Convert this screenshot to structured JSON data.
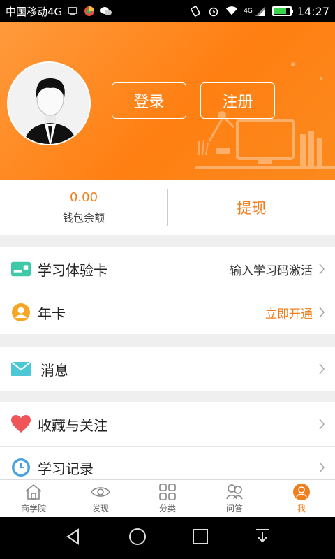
{
  "status_bar": {
    "carrier": "中国移动4G",
    "network_badge": "4G",
    "time": "14:27",
    "icons": [
      "usb-icon",
      "app-icon",
      "wechat-icon",
      "vibrate-icon",
      "alarm-icon",
      "wifi-icon",
      "signal-icon",
      "battery-icon"
    ]
  },
  "header": {
    "login_label": "登录",
    "register_label": "注册"
  },
  "wallet": {
    "balance": "0.00",
    "balance_label": "钱包余额",
    "withdraw_label": "提现"
  },
  "menu": {
    "trial_card": {
      "label": "学习体验卡",
      "action": "输入学习码激活"
    },
    "annual_card": {
      "label": "年卡",
      "action": "立即开通"
    },
    "messages": {
      "label": "消息"
    },
    "favorites": {
      "label": "收藏与关注"
    },
    "history": {
      "label": "学习记录"
    }
  },
  "tabs": [
    {
      "label": "商学院",
      "icon": "home-icon"
    },
    {
      "label": "发现",
      "icon": "eye-icon"
    },
    {
      "label": "分类",
      "icon": "grid-icon"
    },
    {
      "label": "问答",
      "icon": "people-icon"
    },
    {
      "label": "我",
      "icon": "user-icon"
    }
  ],
  "colors": {
    "accent": "#f07e1c",
    "header": "#ff8418",
    "trial_icon": "#3fc9a8",
    "annual_icon": "#f5a623",
    "message_icon": "#4dc7d6",
    "favorite_icon": "#f0555a",
    "history_icon": "#4aa3e0"
  }
}
